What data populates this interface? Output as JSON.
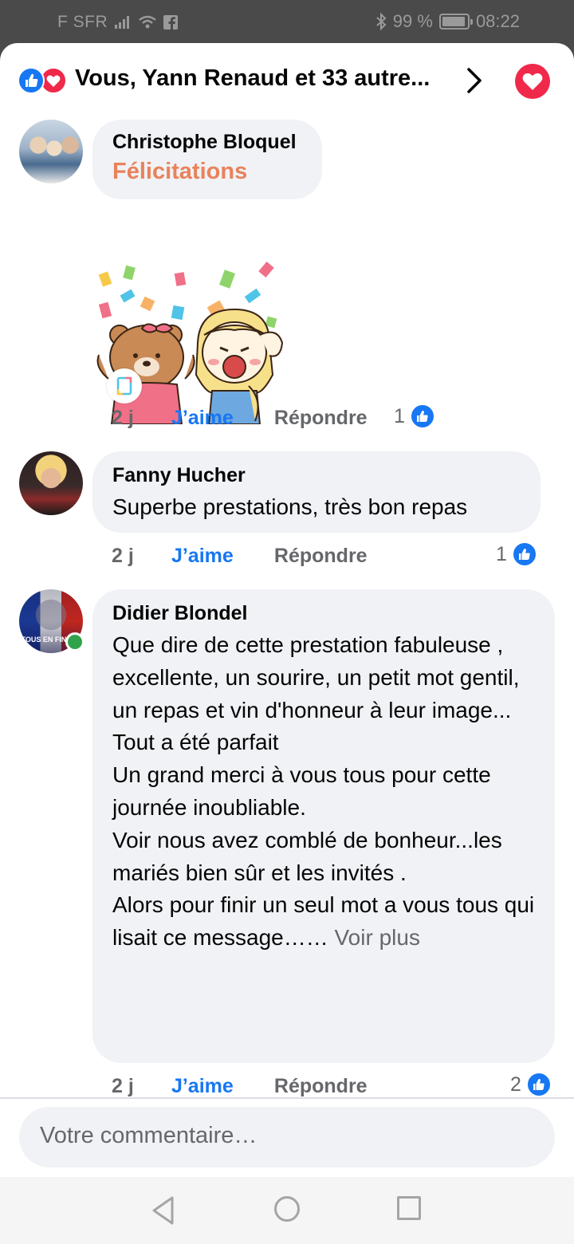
{
  "status_bar": {
    "carrier": "F SFR",
    "battery": "99 %",
    "time": "08:22"
  },
  "header": {
    "title": "Vous, Yann Renaud et 33 autre...",
    "reaction_icons": [
      "like-icon",
      "love-icon"
    ]
  },
  "comments": [
    {
      "author": "Christophe Bloquel",
      "text": "Félicitations",
      "time": "2 j",
      "like_label": "J’aime",
      "reply_label": "Répondre",
      "like_count": "1"
    },
    {
      "author": "Fanny Hucher",
      "text": "Superbe prestations, très bon repas",
      "time": "2 j",
      "like_label": "J’aime",
      "reply_label": "Répondre",
      "like_count": "1"
    },
    {
      "author": "Didier Blondel",
      "text": "Que dire de cette prestation fabuleuse , excellente, un sourire, un petit mot gentil, un repas et vin d'honneur à leur image...\nTout a été parfait\nUn grand merci à vous tous pour cette journée inoubliable.\nVoir nous avez comblé de bonheur...les mariés bien sûr et les invités .\nAlors pour finir un seul mot a vous tous qui lisait ce message……",
      "see_more": "Voir plus",
      "avatar_text": "TOUS EN FINALE",
      "time": "2 j",
      "like_label": "J’aime",
      "reply_label": "Répondre",
      "like_count": "2"
    }
  ],
  "composer": {
    "placeholder": "Votre commentaire…"
  },
  "colors": {
    "facebook_blue": "#1877f2",
    "love_red": "#f02849",
    "bubble_gray": "#f0f2f5",
    "secondary_text": "#65676b",
    "congrats_orange": "#e9825b"
  }
}
